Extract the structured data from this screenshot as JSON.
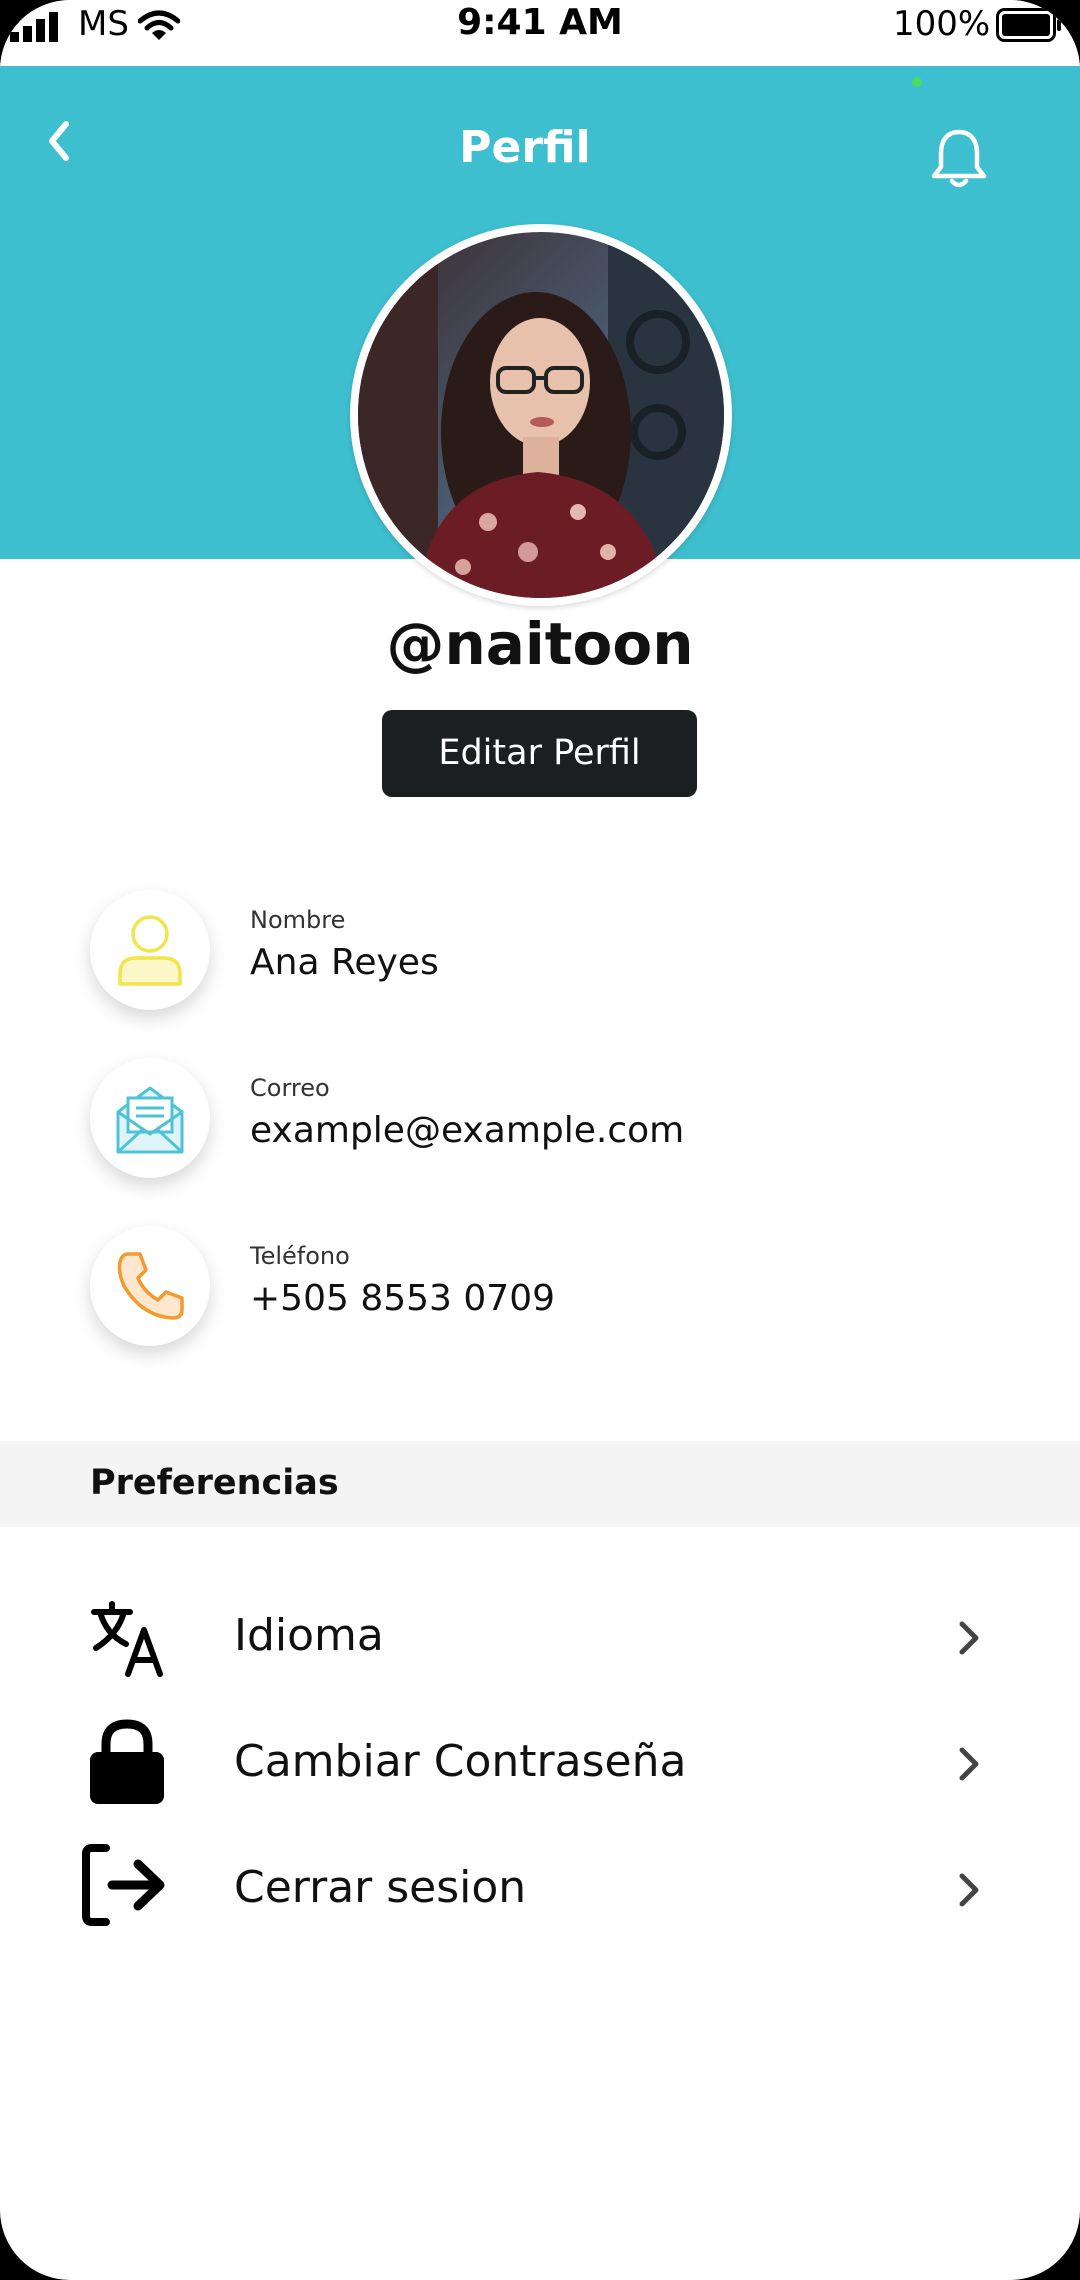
{
  "status_bar": {
    "carrier": "MS",
    "time": "9:41 AM",
    "battery": "100%"
  },
  "header": {
    "title": "Perfil",
    "background_color": "#3ebfcf"
  },
  "profile": {
    "username": "@naitoon",
    "edit_button": "Editar Perfil"
  },
  "info": [
    {
      "label": "Nombre",
      "value": "Ana Reyes",
      "icon": "user-icon",
      "color": "#f2e44a"
    },
    {
      "label": "Correo",
      "value": "example@example.com",
      "icon": "mail-icon",
      "color": "#4fc3d6"
    },
    {
      "label": "Teléfono",
      "value": "+505 8553 0709",
      "icon": "phone-icon",
      "color": "#f29a2e"
    }
  ],
  "preferences": {
    "title": "Preferencias",
    "items": [
      {
        "label": "Idioma",
        "icon": "translate-icon"
      },
      {
        "label": "Cambiar Contraseña",
        "icon": "lock-icon"
      },
      {
        "label": "Cerrar sesion",
        "icon": "logout-icon"
      }
    ]
  }
}
